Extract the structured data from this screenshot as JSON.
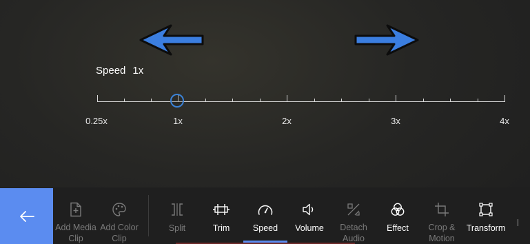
{
  "speed": {
    "label": "Speed",
    "value": "1x",
    "current": 1,
    "min": 0.25,
    "max": 4,
    "tick_labels": [
      "0.25x",
      "1x",
      "2x",
      "3x",
      "4x"
    ]
  },
  "toolbar": {
    "back_icon": "arrow-left-icon",
    "tools": [
      {
        "id": "add-media-clip",
        "label": "Add Media\nClip",
        "icon": "add-file-icon",
        "enabled": false
      },
      {
        "id": "add-color-clip",
        "label": "Add Color\nClip",
        "icon": "palette-icon",
        "enabled": false
      },
      {
        "id": "split",
        "label": "Split",
        "icon": "split-icon",
        "enabled": false
      },
      {
        "id": "trim",
        "label": "Trim",
        "icon": "trim-icon",
        "enabled": true
      },
      {
        "id": "speed",
        "label": "Speed",
        "icon": "speedometer-icon",
        "enabled": true,
        "active": true
      },
      {
        "id": "volume",
        "label": "Volume",
        "icon": "volume-icon",
        "enabled": true
      },
      {
        "id": "detach-audio",
        "label": "Detach\nAudio",
        "icon": "detach-audio-icon",
        "enabled": false
      },
      {
        "id": "effect",
        "label": "Effect",
        "icon": "effect-icon",
        "enabled": true
      },
      {
        "id": "crop-motion",
        "label": "Crop &\nMotion",
        "icon": "crop-icon",
        "enabled": false
      },
      {
        "id": "transform",
        "label": "Transform",
        "icon": "transform-icon",
        "enabled": true
      }
    ]
  },
  "colors": {
    "accent": "#5b8cf0",
    "arrow_fill": "#3b7ee0",
    "disabled_text": "#7a7a7a"
  }
}
